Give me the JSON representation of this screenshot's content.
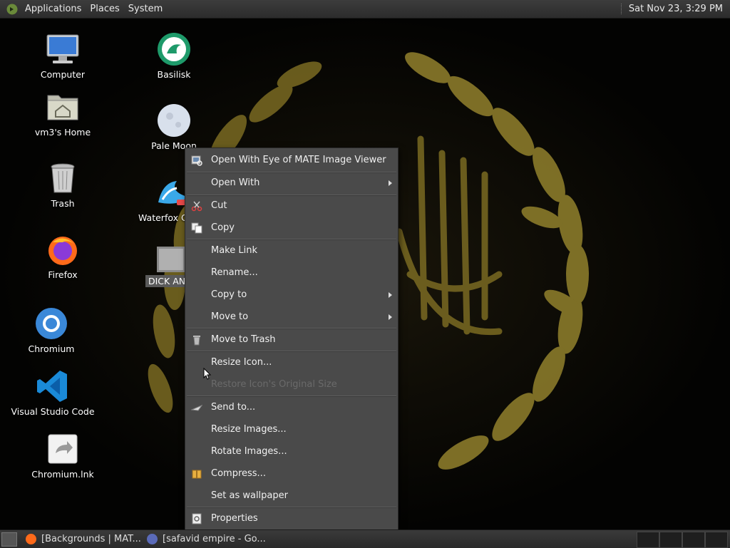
{
  "top_panel": {
    "menus": [
      "Applications",
      "Places",
      "System"
    ],
    "clock": "Sat Nov 23,  3:29 PM"
  },
  "desktop": {
    "icons": [
      {
        "label": "Computer",
        "icon": "computer-icon"
      },
      {
        "label": "vm3's Home",
        "icon": "home-folder-icon"
      },
      {
        "label": "Trash",
        "icon": "trash-icon"
      },
      {
        "label": "Firefox",
        "icon": "firefox-icon"
      },
      {
        "label": "Chromium",
        "icon": "chromium-icon"
      },
      {
        "label": "Visual Studio Code",
        "icon": "vscode-icon"
      },
      {
        "label": "Chromium.lnk",
        "icon": "shortcut-icon"
      },
      {
        "label": "Basilisk",
        "icon": "basilisk-icon"
      },
      {
        "label": "Pale Moon",
        "icon": "palemoon-icon"
      },
      {
        "label": "Waterfox C",
        "icon": "waterfox-icon"
      },
      {
        "label": "DICK AN",
        "icon": "image-file-icon"
      }
    ]
  },
  "context_menu": {
    "items": [
      {
        "label": "Open With Eye of MATE Image Viewer",
        "icon": "image-viewer-icon"
      },
      {
        "label": "Open With",
        "submenu": true
      },
      {
        "label": "Cut",
        "icon": "scissors-icon"
      },
      {
        "label": "Copy",
        "icon": "copy-icon"
      },
      {
        "label": "Make Link"
      },
      {
        "label": "Rename..."
      },
      {
        "label": "Copy to",
        "submenu": true
      },
      {
        "label": "Move to",
        "submenu": true
      },
      {
        "label": "Move to Trash",
        "icon": "trash-icon"
      },
      {
        "label": "Resize Icon..."
      },
      {
        "label": "Restore Icon's Original Size",
        "disabled": true
      },
      {
        "label": "Send to...",
        "icon": "send-icon"
      },
      {
        "label": "Resize Images..."
      },
      {
        "label": "Rotate Images..."
      },
      {
        "label": "Compress...",
        "icon": "archive-icon"
      },
      {
        "label": "Set as wallpaper"
      },
      {
        "label": "Properties",
        "icon": "properties-icon"
      }
    ]
  },
  "bottom_panel": {
    "tasks": [
      {
        "label": "[Backgrounds | MAT...",
        "icon": "firefox-icon"
      },
      {
        "label": "[safavid empire - Go...",
        "icon": "browser-icon"
      }
    ]
  },
  "colors": {
    "panel": "#2e2e2e",
    "menu_bg": "#4a4a4a",
    "wallpaper_gold": "#8a7a2a"
  }
}
